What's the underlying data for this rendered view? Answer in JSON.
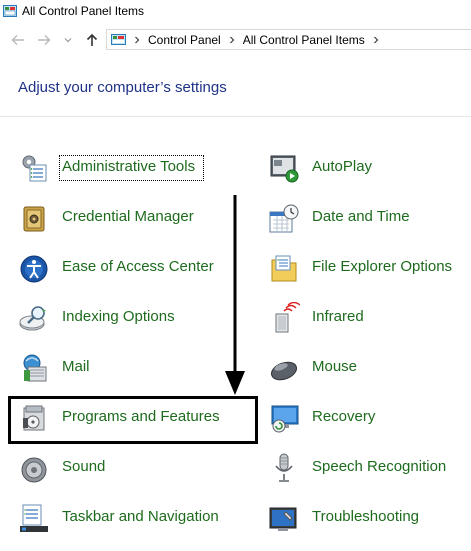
{
  "window": {
    "title": "All Control Panel Items"
  },
  "breadcrumb": {
    "items": [
      "Control Panel",
      "All Control Panel Items"
    ]
  },
  "heading": "Adjust your computer’s settings",
  "left_column": [
    {
      "label": "Administrative Tools",
      "icon": "administrative-tools-icon"
    },
    {
      "label": "Credential Manager",
      "icon": "credential-manager-icon"
    },
    {
      "label": "Ease of Access Center",
      "icon": "ease-of-access-icon"
    },
    {
      "label": "Indexing Options",
      "icon": "indexing-options-icon"
    },
    {
      "label": "Mail",
      "icon": "mail-icon"
    },
    {
      "label": "Programs and Features",
      "icon": "programs-features-icon"
    },
    {
      "label": "Sound",
      "icon": "sound-icon"
    },
    {
      "label": "Taskbar and Navigation",
      "icon": "taskbar-icon"
    }
  ],
  "right_column": [
    {
      "label": "AutoPlay",
      "icon": "autoplay-icon"
    },
    {
      "label": "Date and Time",
      "icon": "date-time-icon"
    },
    {
      "label": "File Explorer Options",
      "icon": "file-explorer-options-icon"
    },
    {
      "label": "Infrared",
      "icon": "infrared-icon"
    },
    {
      "label": "Mouse",
      "icon": "mouse-icon"
    },
    {
      "label": "Recovery",
      "icon": "recovery-icon"
    },
    {
      "label": "Speech Recognition",
      "icon": "microphone-icon"
    },
    {
      "label": "Troubleshooting",
      "icon": "troubleshooting-icon"
    }
  ],
  "colors": {
    "link_green": "#1e6b1e",
    "heading_blue": "#1e3287"
  }
}
